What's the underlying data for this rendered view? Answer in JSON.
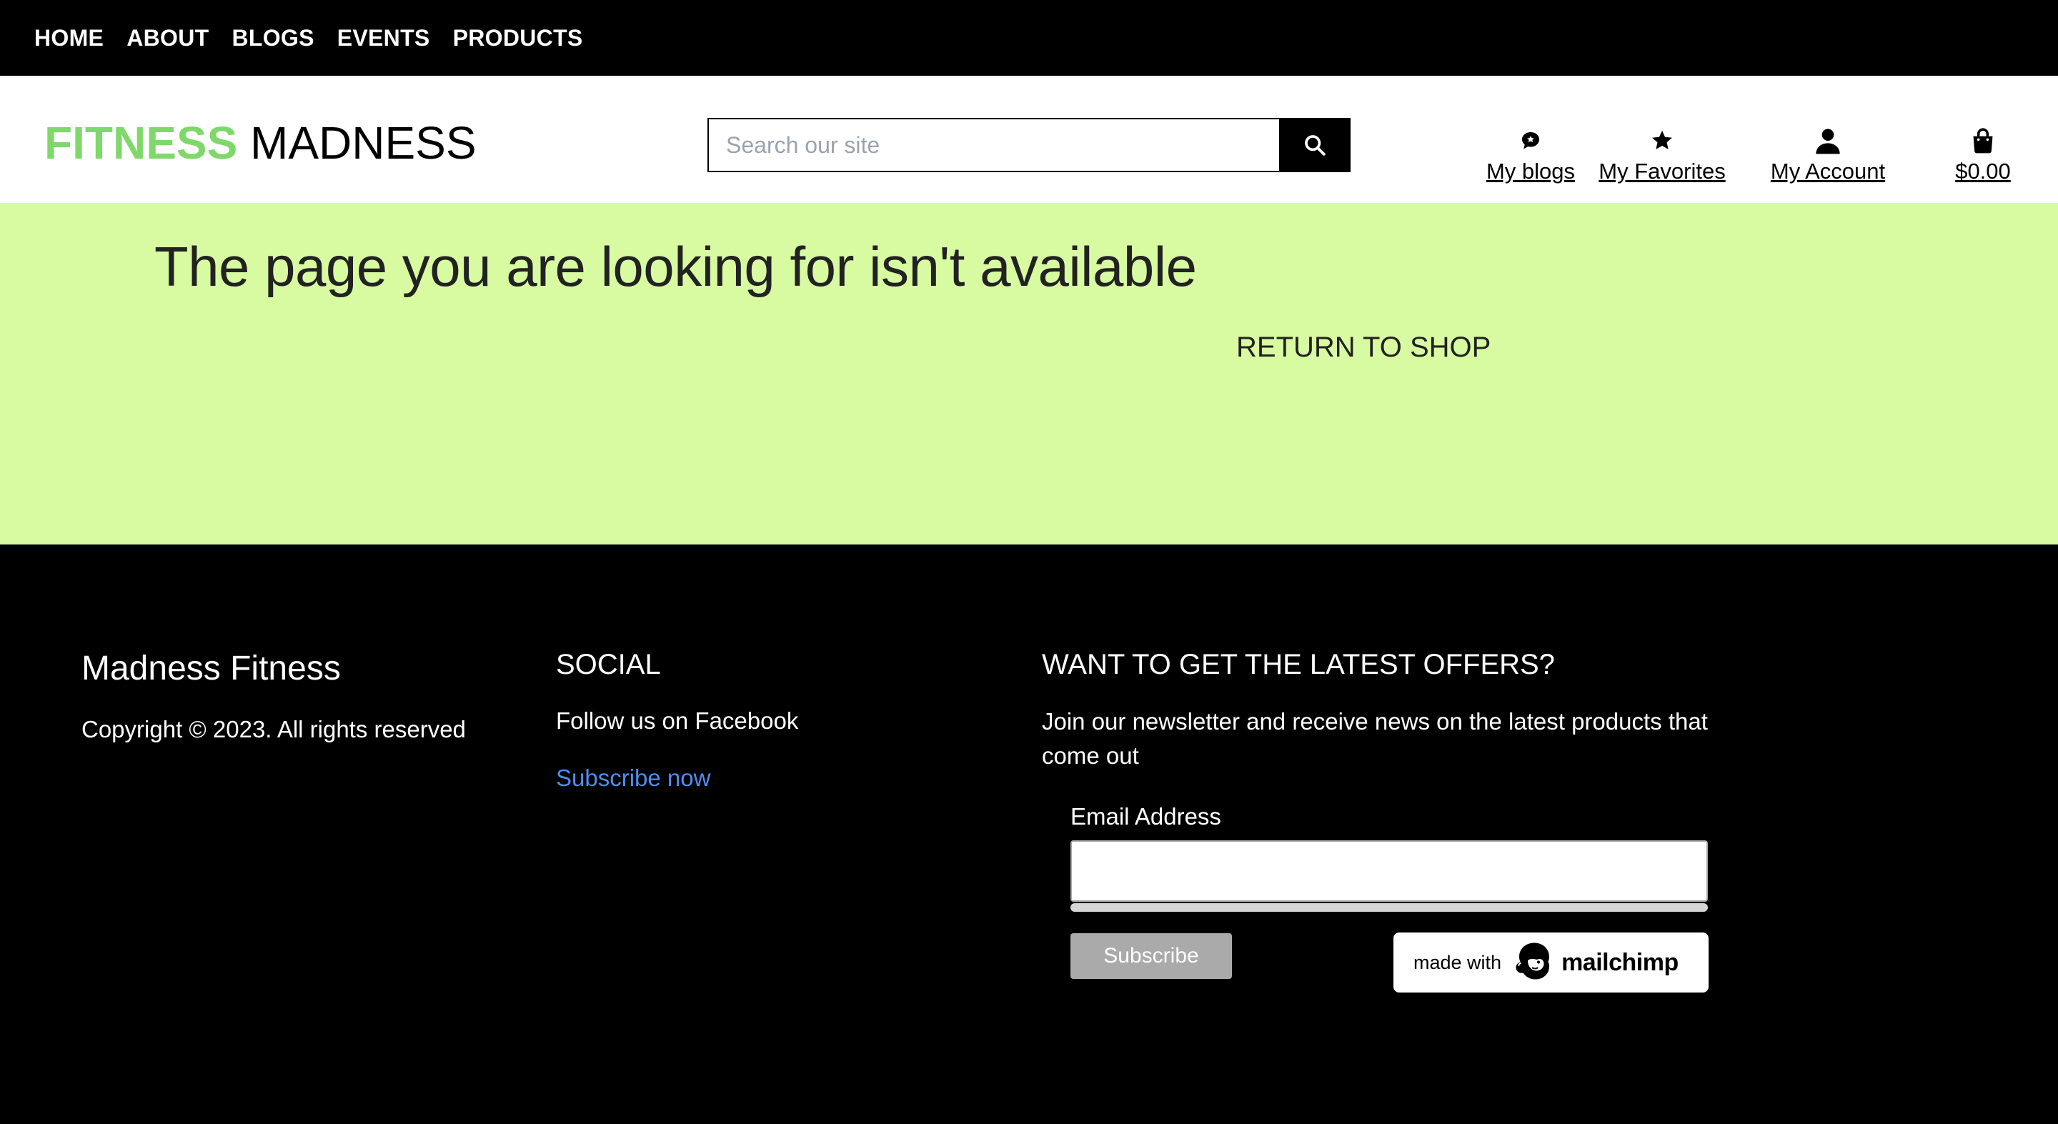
{
  "topnav": {
    "items": [
      "HOME",
      "ABOUT",
      "BLOGS",
      "EVENTS",
      "PRODUCTS"
    ]
  },
  "header": {
    "logo_part1": "FITNESS",
    "logo_part2": "MADNESS",
    "logo_part1_color": "#7fd86a",
    "search_placeholder": "Search our site",
    "search_icon": "search-icon",
    "my_blogs": "My blogs",
    "my_favorites": "My Favorites",
    "my_account": "My Account",
    "cart_total": "$0.00"
  },
  "main": {
    "background": "#d8fba2",
    "heading": "The page you are looking for isn't available",
    "return_link": "RETURN TO SHOP"
  },
  "footer": {
    "brand": "Madness Fitness",
    "copyright": "Copyright © 2023. All rights reserved",
    "social_heading": "SOCIAL",
    "follow": "Follow us on Facebook",
    "subscribe_link": "Subscribe now",
    "newsletter_heading": "WANT TO GET THE LATEST OFFERS?",
    "newsletter_text": "Join our newsletter and receive news on the latest products that come out",
    "email_label": "Email Address",
    "email_value": "",
    "subscribe_button": "Subscribe",
    "made_with": "made with",
    "mailchimp": "mailchimp"
  }
}
